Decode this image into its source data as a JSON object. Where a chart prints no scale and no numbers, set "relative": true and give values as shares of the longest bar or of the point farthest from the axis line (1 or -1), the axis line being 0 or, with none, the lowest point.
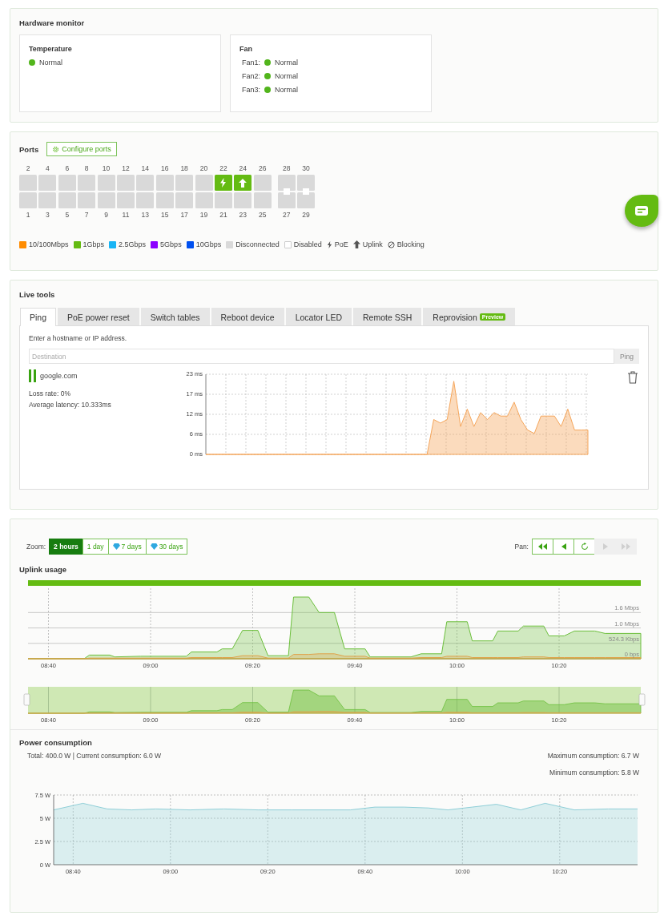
{
  "hardware_monitor": {
    "title": "Hardware monitor",
    "temperature": {
      "title": "Temperature",
      "status": "Normal",
      "color": "#52b51c"
    },
    "fan": {
      "title": "Fan",
      "fans": [
        {
          "label": "Fan1:",
          "status": "Normal",
          "color": "#52b51c"
        },
        {
          "label": "Fan2:",
          "status": "Normal",
          "color": "#52b51c"
        },
        {
          "label": "Fan3:",
          "status": "Normal",
          "color": "#52b51c"
        }
      ]
    }
  },
  "ports": {
    "title": "Ports",
    "configure_button": "Configure ports",
    "groups": [
      {
        "kind": "copper",
        "columns": [
          {
            "top": {
              "number": "2",
              "color": "#d9d9d9"
            },
            "bottom": {
              "number": "1",
              "color": "#d9d9d9"
            }
          },
          {
            "top": {
              "number": "4",
              "color": "#d9d9d9"
            },
            "bottom": {
              "number": "3",
              "color": "#d9d9d9"
            }
          },
          {
            "top": {
              "number": "6",
              "color": "#d9d9d9"
            },
            "bottom": {
              "number": "5",
              "color": "#d9d9d9"
            }
          },
          {
            "top": {
              "number": "8",
              "color": "#d9d9d9"
            },
            "bottom": {
              "number": "7",
              "color": "#d9d9d9"
            }
          },
          {
            "top": {
              "number": "10",
              "color": "#d9d9d9"
            },
            "bottom": {
              "number": "9",
              "color": "#d9d9d9"
            }
          },
          {
            "top": {
              "number": "12",
              "color": "#d9d9d9"
            },
            "bottom": {
              "number": "11",
              "color": "#d9d9d9"
            }
          },
          {
            "top": {
              "number": "14",
              "color": "#d9d9d9"
            },
            "bottom": {
              "number": "13",
              "color": "#d9d9d9"
            }
          },
          {
            "top": {
              "number": "16",
              "color": "#d9d9d9"
            },
            "bottom": {
              "number": "15",
              "color": "#d9d9d9"
            }
          },
          {
            "top": {
              "number": "18",
              "color": "#d9d9d9"
            },
            "bottom": {
              "number": "17",
              "color": "#d9d9d9"
            }
          },
          {
            "top": {
              "number": "20",
              "color": "#d9d9d9"
            },
            "bottom": {
              "number": "19",
              "color": "#d9d9d9"
            }
          },
          {
            "top": {
              "number": "22",
              "color": "#64bb12",
              "kind": "poe"
            },
            "bottom": {
              "number": "21",
              "color": "#d9d9d9"
            }
          },
          {
            "top": {
              "number": "24",
              "color": "#64bb12",
              "kind": "uplink"
            },
            "bottom": {
              "number": "23",
              "color": "#d9d9d9"
            }
          },
          {
            "top": {
              "number": "26",
              "color": "#d9d9d9"
            },
            "bottom": {
              "number": "25",
              "color": "#d9d9d9"
            }
          }
        ]
      },
      {
        "kind": "sfp",
        "columns": [
          {
            "top": {
              "number": "28",
              "color": "#d9d9d9"
            },
            "bottom": {
              "number": "27",
              "color": "#d9d9d9"
            }
          },
          {
            "top": {
              "number": "30",
              "color": "#d9d9d9"
            },
            "bottom": {
              "number": "29",
              "color": "#d9d9d9"
            }
          }
        ]
      }
    ],
    "legend": [
      {
        "kind": "swatch",
        "label": "10/100Mbps",
        "color": "#ff8c00"
      },
      {
        "kind": "swatch",
        "label": "1Gbps",
        "color": "#64bb12"
      },
      {
        "kind": "swatch",
        "label": "2.5Gbps",
        "color": "#18b4f5"
      },
      {
        "kind": "swatch",
        "label": "5Gbps",
        "color": "#8b00ff"
      },
      {
        "kind": "swatch",
        "label": "10Gbps",
        "color": "#0050f0"
      },
      {
        "kind": "swatch",
        "label": "Disconnected",
        "color": "#d9d9d9"
      },
      {
        "kind": "outline",
        "label": "Disabled"
      },
      {
        "kind": "poe",
        "label": "PoE"
      },
      {
        "kind": "uplink",
        "label": "Uplink"
      },
      {
        "kind": "blocking",
        "label": "Blocking"
      }
    ]
  },
  "live_tools": {
    "title": "Live tools",
    "tabs": [
      {
        "label": "Ping",
        "selected": true
      },
      {
        "label": "PoE power reset",
        "selected": false
      },
      {
        "label": "Switch tables",
        "selected": false
      },
      {
        "label": "Reboot device",
        "selected": false
      },
      {
        "label": "Locator LED",
        "selected": false
      },
      {
        "label": "Remote SSH",
        "selected": false
      },
      {
        "label": "Reprovision",
        "selected": false,
        "badge": "Preview"
      }
    ],
    "hint": "Enter a hostname or IP address.",
    "destination": {
      "placeholder": "Destination"
    },
    "ping_button": {
      "label": "Ping",
      "disabled": true
    },
    "result": {
      "host": "google.com",
      "running": true,
      "loss_rate": "Loss rate: 0%",
      "average_latency": "Average latency: 10.333ms",
      "chart_data": {
        "type": "area",
        "grid": true,
        "series": [
          {
            "color": "#f5a55a",
            "values": [
              0,
              0,
              0,
              0,
              0,
              0,
              0,
              0,
              0,
              0,
              0,
              0,
              0,
              0,
              0,
              0,
              0,
              0,
              0,
              0,
              0,
              0,
              0,
              0,
              0,
              0,
              0,
              0,
              0,
              0,
              0,
              0,
              0,
              0,
              10,
              9,
              10,
              21,
              8,
              13,
              8,
              12,
              10,
              12,
              11,
              11,
              15,
              10,
              7,
              6,
              11,
              11,
              11,
              8,
              13,
              7,
              7,
              7
            ]
          }
        ],
        "ylim": [
          0,
          23
        ],
        "yticks": [
          {
            "value": 0,
            "label": "0 ms"
          },
          {
            "value": 5.75,
            "label": "6 ms"
          },
          {
            "value": 11.5,
            "label": "12 ms"
          },
          {
            "value": 17.25,
            "label": "17 ms"
          },
          {
            "value": 23,
            "label": "23 ms"
          }
        ]
      }
    }
  },
  "usage": {
    "zoom_label": "Zoom:",
    "zoom_options": [
      {
        "label": "2 hours",
        "selected": true,
        "premium": false
      },
      {
        "label": "1 day",
        "selected": false,
        "premium": false
      },
      {
        "label": "7 days",
        "selected": false,
        "premium": true
      },
      {
        "label": "30 days",
        "selected": false,
        "premium": true
      }
    ],
    "pan_label": "Pan:",
    "pan_buttons": [
      {
        "kind": "first",
        "disabled": false
      },
      {
        "kind": "back",
        "disabled": false
      },
      {
        "kind": "reset",
        "disabled": false
      },
      {
        "kind": "forward",
        "disabled": true
      },
      {
        "kind": "last",
        "disabled": true
      }
    ],
    "uplink": {
      "title": "Uplink usage",
      "y_labels": [
        "1.6 Mbps",
        "1.0 Mbps",
        "524.3 Kbps",
        "0 bps"
      ],
      "chart_data": {
        "type": "area",
        "relative": true,
        "grid": true,
        "x": [
          516,
          527,
          528,
          532,
          533,
          538,
          547,
          548,
          553,
          554,
          556,
          558,
          561,
          563,
          567,
          568,
          571,
          573,
          576,
          578,
          582,
          583,
          591,
          593,
          597,
          598,
          602,
          603,
          607,
          608,
          612,
          613,
          617,
          618,
          621,
          623,
          627,
          629,
          636
        ],
        "series": [
          {
            "color": "#6cbf3c",
            "values": [
              0,
              0,
              0.06,
              0.06,
              0.03,
              0.04,
              0.04,
              0.11,
              0.11,
              0.16,
              0.16,
              0.46,
              0.46,
              0.05,
              0.05,
              1,
              1,
              0.75,
              0.75,
              0.16,
              0.16,
              0.03,
              0.03,
              0.08,
              0.08,
              0.6,
              0.6,
              0.29,
              0.29,
              0.45,
              0.45,
              0.53,
              0.53,
              0.37,
              0.37,
              0.45,
              0.45,
              0.41,
              0.41
            ]
          },
          {
            "color": "#e0a24a",
            "values": [
              0,
              0,
              0.01,
              0.01,
              0.01,
              0.01,
              0.01,
              0.02,
              0.02,
              0.02,
              0.02,
              0.05,
              0.05,
              0.01,
              0.01,
              0.07,
              0.07,
              0.08,
              0.08,
              0.04,
              0.04,
              0.01,
              0.01,
              0.02,
              0.02,
              0.04,
              0.04,
              0.02,
              0.02,
              0.02,
              0.02,
              0.03,
              0.03,
              0.02,
              0.02,
              0.02,
              0.02,
              0.02,
              0.02
            ]
          }
        ],
        "xlim": [
          516,
          636
        ],
        "xticks": [
          {
            "value": 520,
            "label": "08:40"
          },
          {
            "value": 540,
            "label": "09:00"
          },
          {
            "value": 560,
            "label": "09:20"
          },
          {
            "value": 580,
            "label": "09:40"
          },
          {
            "value": 600,
            "label": "10:00"
          },
          {
            "value": 620,
            "label": "10:20"
          }
        ]
      },
      "navigator_labels": [
        "08:40",
        "09:00",
        "09:20",
        "09:40",
        "10:00",
        "10:20"
      ]
    },
    "power": {
      "title": "Power consumption",
      "summary": "Total: 400.0 W | Current consumption: 6.0 W",
      "maximum": "Maximum consumption: 6.7 W",
      "minimum": "Minimum consumption: 5.8 W",
      "chart_data": {
        "type": "area",
        "grid": true,
        "x": [
          516,
          522,
          527,
          532,
          537,
          544,
          551,
          558,
          565,
          577,
          582,
          588,
          593,
          597,
          602,
          607,
          612,
          617,
          623,
          630,
          636
        ],
        "series": [
          {
            "color": "#8fcfd8",
            "values": [
              5.9,
              6.6,
              6,
              5.9,
              6,
              5.9,
              6,
              5.9,
              5.9,
              5.9,
              6.2,
              6.2,
              6.1,
              5.9,
              6.2,
              6.5,
              5.9,
              6.6,
              5.9,
              6,
              6
            ]
          }
        ],
        "xlim": [
          516,
          636
        ],
        "ylim": [
          0,
          7.5
        ],
        "xticks": [
          {
            "value": 520,
            "label": "08:40"
          },
          {
            "value": 540,
            "label": "09:00"
          },
          {
            "value": 560,
            "label": "09:20"
          },
          {
            "value": 580,
            "label": "09:40"
          },
          {
            "value": 600,
            "label": "10:00"
          },
          {
            "value": 620,
            "label": "10:20"
          }
        ],
        "yticks": [
          {
            "value": 0,
            "label": "0 W"
          },
          {
            "value": 2.5,
            "label": "2.5 W"
          },
          {
            "value": 5,
            "label": "5 W"
          },
          {
            "value": 7.5,
            "label": "7.5 W"
          }
        ]
      }
    }
  }
}
